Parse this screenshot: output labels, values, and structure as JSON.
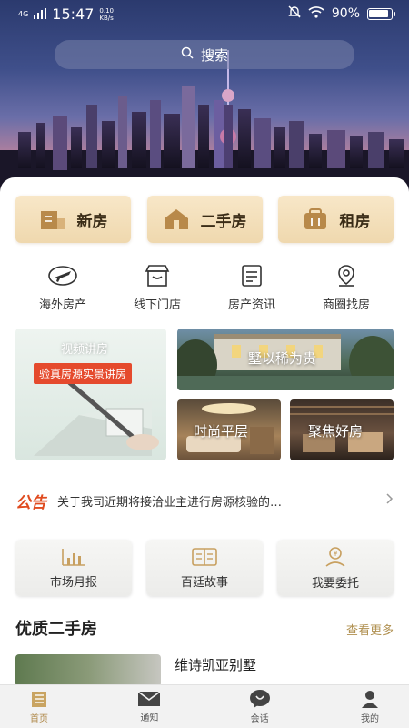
{
  "status": {
    "time": "15:47",
    "network": "4G",
    "speed_value": "0.10",
    "speed_unit": "KB/s",
    "battery": "90%"
  },
  "search": {
    "placeholder": "搜索"
  },
  "main_tabs": [
    {
      "label": "新房"
    },
    {
      "label": "二手房"
    },
    {
      "label": "租房"
    }
  ],
  "categories": [
    {
      "label": "海外房产",
      "icon": "plane-icon"
    },
    {
      "label": "线下门店",
      "icon": "store-icon"
    },
    {
      "label": "房产资讯",
      "icon": "news-icon"
    },
    {
      "label": "商圈找房",
      "icon": "location-pin-icon"
    }
  ],
  "banners": {
    "video_title": "视频讲房",
    "video_badge": "验真房源实景讲房",
    "villa": "墅以稀为贵",
    "flat": "时尚平层",
    "good": "聚焦好房"
  },
  "notice": {
    "tag": "公告",
    "text": "关于我司近期将接洽业主进行房源核验的…"
  },
  "tiles": [
    {
      "label": "市场月报",
      "icon": "chart-icon"
    },
    {
      "label": "百廷故事",
      "icon": "book-icon"
    },
    {
      "label": "我要委托",
      "icon": "entrust-icon"
    }
  ],
  "section": {
    "title": "优质二手房",
    "more": "查看更多"
  },
  "listing": {
    "name": "维诗凯亚别墅"
  },
  "nav": [
    {
      "label": "首页"
    },
    {
      "label": "通知"
    },
    {
      "label": "会话"
    },
    {
      "label": "我的"
    }
  ],
  "colors": {
    "accent": "#b08a4c",
    "notice": "#e04b1f",
    "tab_bg": "#f3dfb9"
  }
}
